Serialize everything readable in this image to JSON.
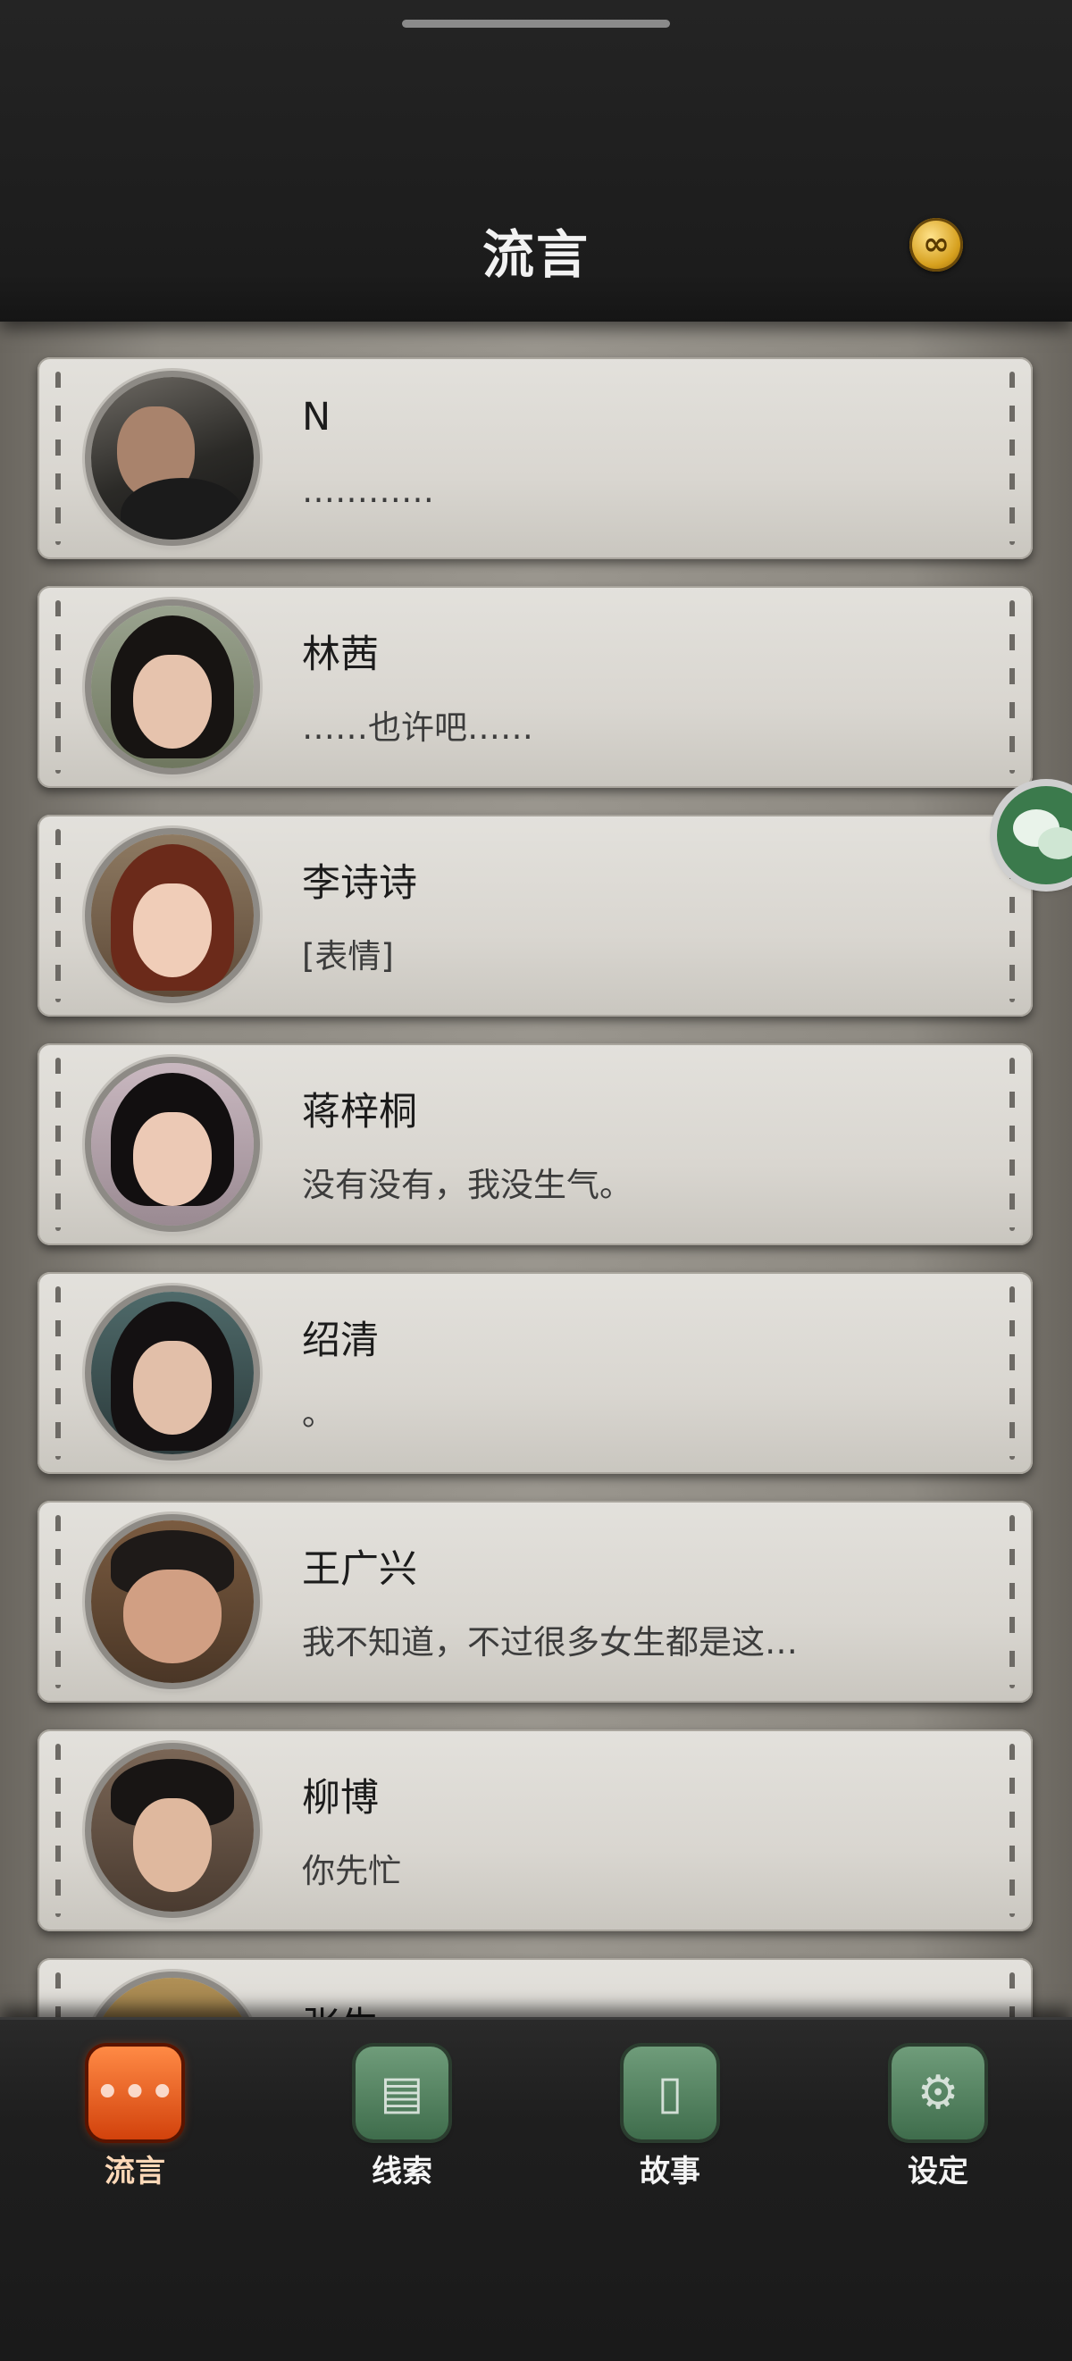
{
  "header": {
    "title": "流言",
    "badge_icon": "infinity-icon"
  },
  "contacts": [
    {
      "name": "N",
      "message": "…………",
      "avatar": "man-beard-avatar"
    },
    {
      "name": "林茜",
      "message": "……也许吧……",
      "avatar": "woman-long-hair-avatar"
    },
    {
      "name": "李诗诗",
      "message": "[表情]",
      "avatar": "woman-red-hair-avatar"
    },
    {
      "name": "蒋梓桐",
      "message": "没有没有，我没生气。",
      "avatar": "woman-bob-avatar"
    },
    {
      "name": "绍清",
      "message": "。",
      "avatar": "woman-dark-hair-avatar"
    },
    {
      "name": "王广兴",
      "message": "我不知道，不过很多女生都是这…",
      "avatar": "man-glasses-avatar"
    },
    {
      "name": "柳博",
      "message": "你先忙",
      "avatar": "man-short-hair-avatar"
    },
    {
      "name": "张生",
      "message": "",
      "avatar": "partial-avatar"
    }
  ],
  "floating": {
    "icon": "wechat-icon"
  },
  "nav": {
    "tabs": [
      {
        "label": "流言",
        "icon": "chat-bubble-icon",
        "active": true
      },
      {
        "label": "线索",
        "icon": "document-icon",
        "active": false
      },
      {
        "label": "故事",
        "icon": "book-icon",
        "active": false
      },
      {
        "label": "设定",
        "icon": "gear-icon",
        "active": false
      }
    ]
  },
  "colors": {
    "active_tab": "#e85a1a",
    "inactive_tab": "#4f7d5b",
    "card_bg": "#dcd9d3"
  }
}
